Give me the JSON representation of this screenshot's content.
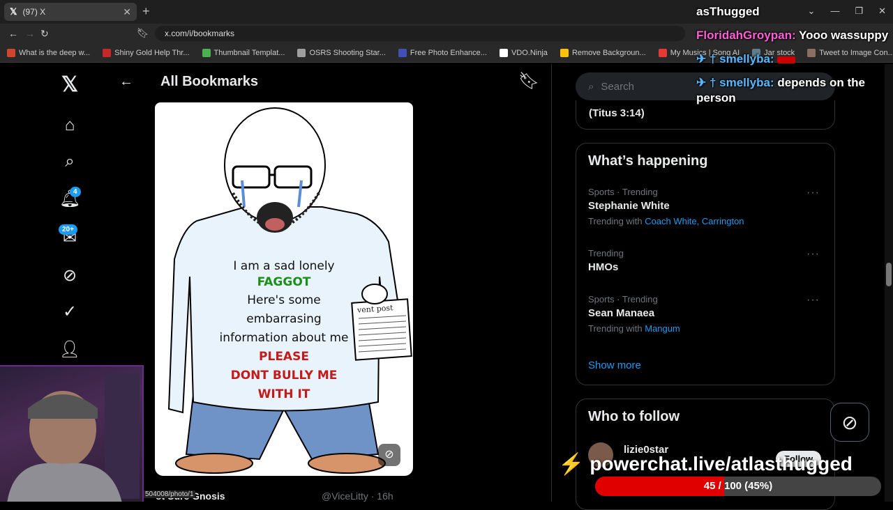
{
  "browser": {
    "tab_title": "(97) X",
    "tab_close": "✕",
    "new_tab": "+",
    "url": "x.com/i/bookmarks",
    "bookmarks": [
      {
        "label": "What is the deep w...",
        "color": "#d0452e"
      },
      {
        "label": "Shiny Gold Help Thr...",
        "color": "#c62828"
      },
      {
        "label": "Thumbnail Templat...",
        "color": "#4caf50"
      },
      {
        "label": "OSRS Shooting Star...",
        "color": "#9e9e9e"
      },
      {
        "label": "Free Photo Enhance...",
        "color": "#3f51b5"
      },
      {
        "label": "VDO.Ninja",
        "color": "#ffffff"
      },
      {
        "label": "Remove Backgroun...",
        "color": "#ffc107"
      },
      {
        "label": "My Musics | Song AI",
        "color": "#e53935"
      },
      {
        "label": "Jar stock",
        "color": "#607d8b"
      },
      {
        "label": "Tweet to Image Con...",
        "color": "#8d6e63"
      }
    ]
  },
  "nav": {
    "notifications_badge": "4",
    "messages_badge": "20+"
  },
  "main": {
    "title": "All Bookmarks",
    "meme_text": {
      "line1": "I am a sad lonely",
      "line2": "FAGGOT",
      "line3": "Here's some",
      "line4": "embarrasing",
      "line5": "information about me",
      "line6": "PLEASE",
      "line7": "DONT BULLY ME",
      "line8": "WITH IT",
      "paper": "vent post"
    },
    "post_author": "ot Sure Gnosis",
    "post_handle": "@ViceLitty · 16h",
    "status_url": "504008/photo/1"
  },
  "sidebar": {
    "search_placeholder": "Search",
    "verse": "(Titus 3:14)",
    "happening_title": "What’s happening",
    "trends": [
      {
        "meta": "Sports · Trending",
        "name": "Stephanie White",
        "with_prefix": "Trending with",
        "with_links": "Coach White, Carrington"
      },
      {
        "meta": "Trending",
        "name": "HMOs",
        "with_prefix": "",
        "with_links": ""
      },
      {
        "meta": "Sports · Trending",
        "name": "Sean Manaea",
        "with_prefix": "Trending with",
        "with_links": "Mangum"
      }
    ],
    "show_more": "Show more",
    "who_to_follow": "Who to follow",
    "follow_user": "lizie0star",
    "follow_button": "Follow"
  },
  "overlay": {
    "streamer_name": "asThugged",
    "chat": [
      {
        "user": "FloridahGroypan:",
        "msg": "Yooo wassuppy",
        "prefix": ""
      },
      {
        "user": "smellyba:",
        "msg": "",
        "prefix": "✈ † "
      },
      {
        "user": "smellyba:",
        "msg": "depends on the person",
        "prefix": "✈ † "
      }
    ],
    "powerchat_url": "powerchat.live/atlasthugged",
    "goal_text": "45 / 100 (45%)",
    "goal_fraction": 0.45
  }
}
